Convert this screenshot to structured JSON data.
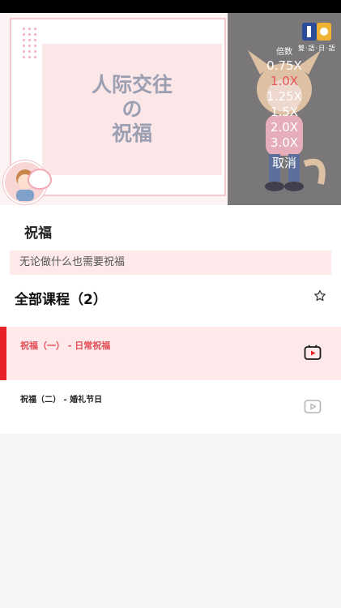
{
  "video": {
    "slide_title_line1": "人际交往",
    "slide_title_line2": "の",
    "slide_title_line3": "祝福",
    "logo_text": "雙·語·日·語",
    "speed_menu": {
      "caption": "倍数",
      "options": [
        "0.75X",
        "1.0X",
        "1.25X",
        "1.5X",
        "2.0X",
        "3.0X"
      ],
      "selected": "1.0X",
      "cancel_label": "取消"
    }
  },
  "course": {
    "title": "祝福",
    "subtitle": "无论做什么也需要祝福",
    "section_title": "全部课程（2）",
    "lessons": [
      {
        "label": "祝福（一） - 日常祝福",
        "active": true
      },
      {
        "label": "祝福（二） - 婚礼节日",
        "active": false
      }
    ]
  },
  "colors": {
    "accent": "#e8202a",
    "active_text": "#e34d55",
    "highlight_bg": "#fde9ea"
  },
  "icons": [
    "star-icon",
    "play-video-icon"
  ]
}
